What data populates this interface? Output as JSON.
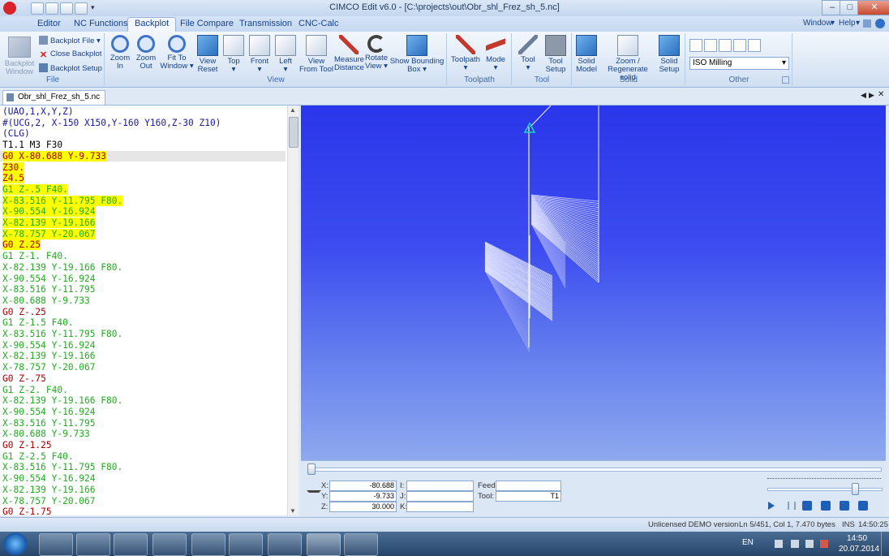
{
  "window": {
    "title": "CIMCO Edit v6.0 - [C:\\projects\\out\\Obr_shl_Frez_sh_5.nc]"
  },
  "menu": {
    "tabs": [
      "Editor",
      "NC Functions",
      "Backplot",
      "File Compare",
      "Transmission",
      "CNC-Calc"
    ],
    "active_tab": "Backplot",
    "right": [
      "Window",
      "Help"
    ]
  },
  "ribbon": {
    "file_group": {
      "label": "File",
      "backplot_window": "Backplot Window",
      "backplot_file": "Backplot File",
      "close_backplot": "Close Backplot",
      "backplot_setup": "Backplot Setup"
    },
    "view_group": {
      "label": "View",
      "buttons": [
        "Zoom In",
        "Zoom Out",
        "Fit To Window",
        "View Reset",
        "Top",
        "Front",
        "Left",
        "View From Tool",
        "Measure Distance",
        "Rotate View",
        "Show Bounding Box"
      ]
    },
    "toolpath_group": {
      "label": "Toolpath",
      "buttons": [
        "Toolpath",
        "Mode"
      ]
    },
    "tool_group": {
      "label": "Tool",
      "buttons": [
        "Tool",
        "Tool Setup"
      ]
    },
    "solid_group": {
      "label": "Solid",
      "buttons": [
        "Solid Model",
        "Zoom / Regenerate solid",
        "Solid Setup"
      ]
    },
    "other_group": {
      "label": "Other",
      "mode_select": "ISO Milling"
    }
  },
  "document": {
    "tab": "Obr_shl_Frez_sh_5.nc"
  },
  "colors": {
    "header": "#1a1a99",
    "rapid": "#a80000",
    "feed": "#22aa22",
    "plain": "#000000",
    "highlight": "#ffff00"
  },
  "nc_lines": [
    {
      "text": "(UAO,1,X,Y,Z)",
      "kind": "header"
    },
    {
      "text": "#(UCG,2, X-150 X150,Y-160 Y160,Z-30 Z10)",
      "kind": "header"
    },
    {
      "text": "(CLG)",
      "kind": "header"
    },
    {
      "text": "T1.1 M3 F30",
      "kind": "plain"
    },
    {
      "text": "G0 X-80.688 Y-9.733",
      "kind": "rapid",
      "hl": true,
      "current": true
    },
    {
      "text": "Z30.",
      "kind": "rapid",
      "hl": true
    },
    {
      "text": "Z4.5",
      "kind": "rapid",
      "hl": true
    },
    {
      "text": "G1 Z-.5 F40.",
      "kind": "feed",
      "hl": true
    },
    {
      "text": "X-83.516 Y-11.795 F80.",
      "kind": "feed",
      "hl": true
    },
    {
      "text": "X-90.554 Y-16.924",
      "kind": "feed",
      "hl": true
    },
    {
      "text": "X-82.139 Y-19.166",
      "kind": "feed",
      "hl": true
    },
    {
      "text": "X-78.757 Y-20.067",
      "kind": "feed",
      "hl": true
    },
    {
      "text": "G0 Z.25",
      "kind": "rapid",
      "hl": true
    },
    {
      "text": "G1 Z-1. F40.",
      "kind": "feed"
    },
    {
      "text": "X-82.139 Y-19.166 F80.",
      "kind": "feed"
    },
    {
      "text": "X-90.554 Y-16.924",
      "kind": "feed"
    },
    {
      "text": "X-83.516 Y-11.795",
      "kind": "feed"
    },
    {
      "text": "X-80.688 Y-9.733",
      "kind": "feed"
    },
    {
      "text": "G0 Z-.25",
      "kind": "rapid"
    },
    {
      "text": "G1 Z-1.5 F40.",
      "kind": "feed"
    },
    {
      "text": "X-83.516 Y-11.795 F80.",
      "kind": "feed"
    },
    {
      "text": "X-90.554 Y-16.924",
      "kind": "feed"
    },
    {
      "text": "X-82.139 Y-19.166",
      "kind": "feed"
    },
    {
      "text": "X-78.757 Y-20.067",
      "kind": "feed"
    },
    {
      "text": "G0 Z-.75",
      "kind": "rapid"
    },
    {
      "text": "G1 Z-2. F40.",
      "kind": "feed"
    },
    {
      "text": "X-82.139 Y-19.166 F80.",
      "kind": "feed"
    },
    {
      "text": "X-90.554 Y-16.924",
      "kind": "feed"
    },
    {
      "text": "X-83.516 Y-11.795",
      "kind": "feed"
    },
    {
      "text": "X-80.688 Y-9.733",
      "kind": "feed"
    },
    {
      "text": "G0 Z-1.25",
      "kind": "rapid"
    },
    {
      "text": "G1 Z-2.5 F40.",
      "kind": "feed"
    },
    {
      "text": "X-83.516 Y-11.795 F80.",
      "kind": "feed"
    },
    {
      "text": "X-90.554 Y-16.924",
      "kind": "feed"
    },
    {
      "text": "X-82.139 Y-19.166",
      "kind": "feed"
    },
    {
      "text": "X-78.757 Y-20.067",
      "kind": "feed"
    },
    {
      "text": "G0 Z-1.75",
      "kind": "rapid"
    }
  ],
  "coords": {
    "x_label": "X:",
    "x": "-80.688",
    "y_label": "Y:",
    "y": "-9.733",
    "z_label": "Z:",
    "z": "30.000",
    "i_label": "I:",
    "i": "",
    "j_label": "J:",
    "j": "",
    "k_label": "K:",
    "k": "",
    "feed_label": "Feed:",
    "feed": "",
    "tool_label": "Tool:",
    "tool": "T1"
  },
  "playback": {
    "progress": 0.0,
    "speed": 0.78
  },
  "status": {
    "license": "Unlicensed DEMO version",
    "position": "Ln 5/451, Col 1, 7.470 bytes",
    "mode": "INS",
    "time": "14:50:25"
  },
  "taskbar": {
    "lang": "EN",
    "clock_time": "14:50",
    "clock_date": "20.07.2014"
  }
}
